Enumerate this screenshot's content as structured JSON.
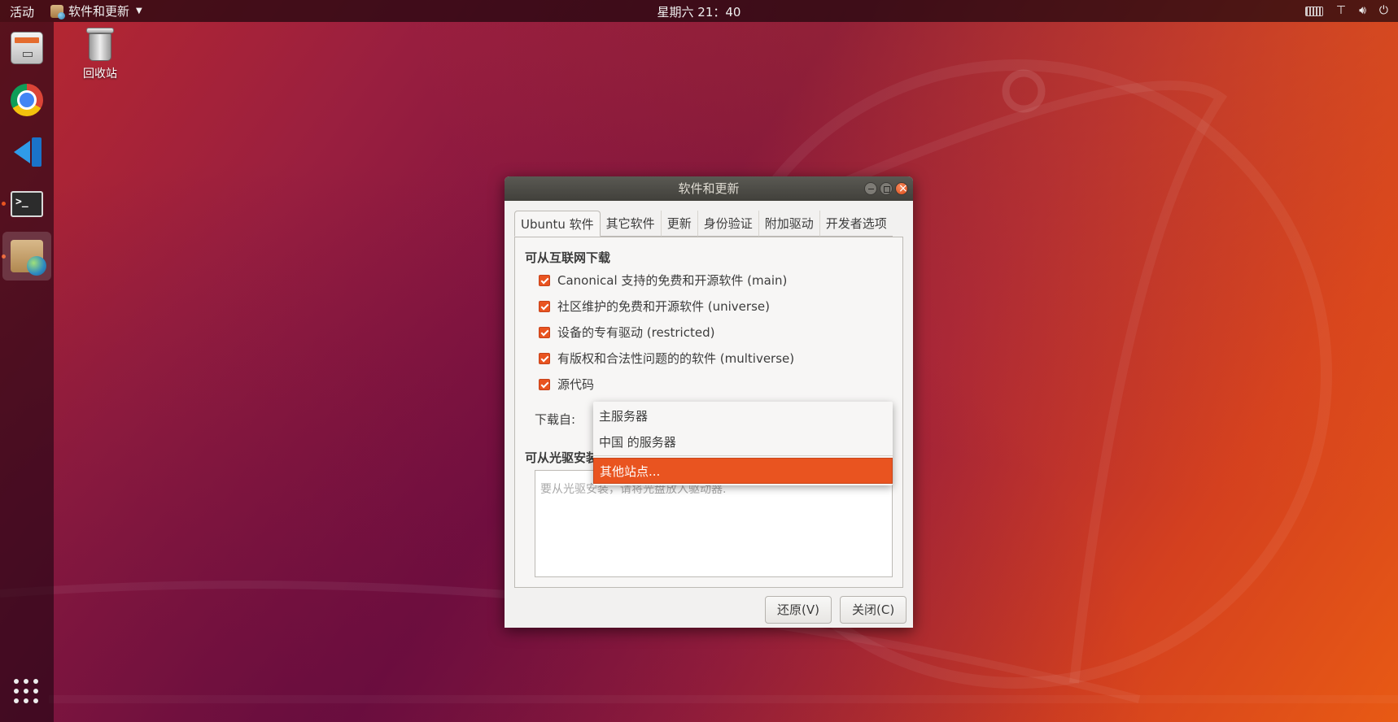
{
  "topbar": {
    "activities": "活动",
    "app_name": "软件和更新",
    "clock": "星期六 21：40"
  },
  "desktop": {
    "trash_label": "回收站"
  },
  "dialog": {
    "title": "软件和更新",
    "tabs": [
      "Ubuntu 软件",
      "其它软件",
      "更新",
      "身份验证",
      "附加驱动",
      "开发者选项"
    ],
    "section_internet": "可从互联网下载",
    "checkboxes": [
      {
        "label": "Canonical 支持的免费和开源软件 (main)",
        "checked": true
      },
      {
        "label": "社区维护的免费和开源软件 (universe)",
        "checked": true
      },
      {
        "label": "设备的专有驱动 (restricted)",
        "checked": true
      },
      {
        "label": "有版权和合法性问题的的软件 (multiverse)",
        "checked": true
      },
      {
        "label": "源代码",
        "checked": true
      }
    ],
    "download_from_label": "下载自:",
    "section_cdrom": "可从光驱安装",
    "cdrom_hint": "要从光驱安装，请将光盘放入驱动器.",
    "revert_button": "还原(V)",
    "close_button": "关闭(C)"
  },
  "dropdown": {
    "options": [
      "主服务器",
      "中国 的服务器",
      "其他站点..."
    ],
    "selected": "其他站点..."
  },
  "colors": {
    "accent": "#e95420",
    "dialog_bg": "#f2f1f0",
    "titlebar": "#41403b"
  }
}
